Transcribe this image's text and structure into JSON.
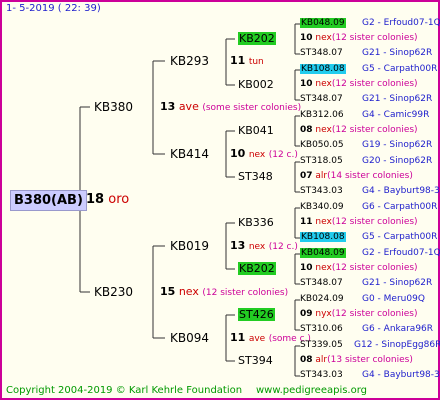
{
  "header_date": "1-  5-2019 (  22:  39)",
  "footer": {
    "copyright": "Copyright 2004-2019 © Karl Kehrle Foundation",
    "site": "www.pedigreeapis.org"
  },
  "colors": {
    "frame": "#cc0099",
    "green_highlight": "#22cc22",
    "cyan_highlight": "#22ccee",
    "root_bg": "#ccccff",
    "blue_text": "#1d1dcc",
    "red_text": "#cc0000"
  },
  "root": {
    "code": "B380(AB)",
    "num": "18",
    "note": "oro"
  },
  "gen1": [
    {
      "code": "KB380",
      "num": "13",
      "note": "ave",
      "ann": "(some sister colonies)"
    },
    {
      "code": "KB230",
      "num": "15",
      "note": "nex",
      "ann": "(12 sister colonies)"
    }
  ],
  "gen2": [
    {
      "code": "KB293",
      "num": "11",
      "note": "tun"
    },
    {
      "code": "KB414",
      "num": "10",
      "note": "nex",
      "ann": "(12 c.)"
    },
    {
      "code": "KB019",
      "num": "13",
      "note": "nex",
      "ann": "(12 c.)"
    },
    {
      "code": "KB094",
      "num": "11",
      "note": "ave",
      "ann": "(some c.)"
    }
  ],
  "gen3": [
    {
      "code": "KB202",
      "hl": "green"
    },
    {
      "code": "KB002"
    },
    {
      "code": "KB041",
      "num": "08",
      "note": "nex",
      "ann": "(12 sister colonies)"
    },
    {
      "code": "ST348",
      "num": "07",
      "note": "alr",
      "ann": "(14 sister colonies)"
    },
    {
      "code": "KB336",
      "num": "11",
      "note": "nex",
      "ann": "(12 sister colonies)"
    },
    {
      "code": "KB202",
      "hl": "green"
    },
    {
      "code": "ST426",
      "hl": "green",
      "num": "09",
      "note": "nyx",
      "ann": "(12 sister colonies)"
    },
    {
      "code": "ST394",
      "num": "08",
      "note": "alr",
      "ann": "(13 sister colonies)"
    }
  ],
  "gen4": [
    {
      "code": "KB048.09",
      "hl": "green",
      "loc": "G2 - Erfoud07-1Q"
    },
    {
      "code": "ST348.07",
      "loc": "G21 - Sinop62R"
    },
    {
      "code": "KB108.08",
      "hl": "cyan",
      "loc": "G5 - Carpath00R"
    },
    {
      "code": "ST348.07",
      "loc": "G21 - Sinop62R"
    },
    {
      "code": "KB312.06",
      "loc": "G4 - Camic99R"
    },
    {
      "code": "KB050.05",
      "loc": "G19 - Sinop62R"
    },
    {
      "code": "ST318.05",
      "loc": "G20 - Sinop62R"
    },
    {
      "code": "ST343.03",
      "loc": "G4 - Bayburt98-3"
    },
    {
      "code": "KB340.09",
      "loc": "G6 - Carpath00R"
    },
    {
      "code": "KB108.08",
      "hl": "cyan",
      "loc": "G5 - Carpath00R"
    },
    {
      "code": "KB048.09",
      "hl": "green",
      "loc": "G2 - Erfoud07-1Q"
    },
    {
      "code": "ST348.07",
      "loc": "G21 - Sinop62R"
    },
    {
      "code": "KB024.09",
      "loc": "G0 - Meru09Q"
    },
    {
      "code": "ST310.06",
      "loc": "G6 - Ankara96R"
    },
    {
      "code": "ST339.05",
      "loc": "G12 - SinopEgg86R"
    },
    {
      "code": "ST343.03",
      "loc": "G4 - Bayburt98-3"
    }
  ],
  "gen4_pair_mid": [
    {
      "num": "10",
      "note": "nex",
      "ann": "(12 sister colonies)"
    },
    {
      "num": "10",
      "note": "nex",
      "ann": "(12 sister colonies)"
    },
    {
      "num": "10",
      "note": "nex",
      "ann": "(12 sister colonies)"
    }
  ]
}
